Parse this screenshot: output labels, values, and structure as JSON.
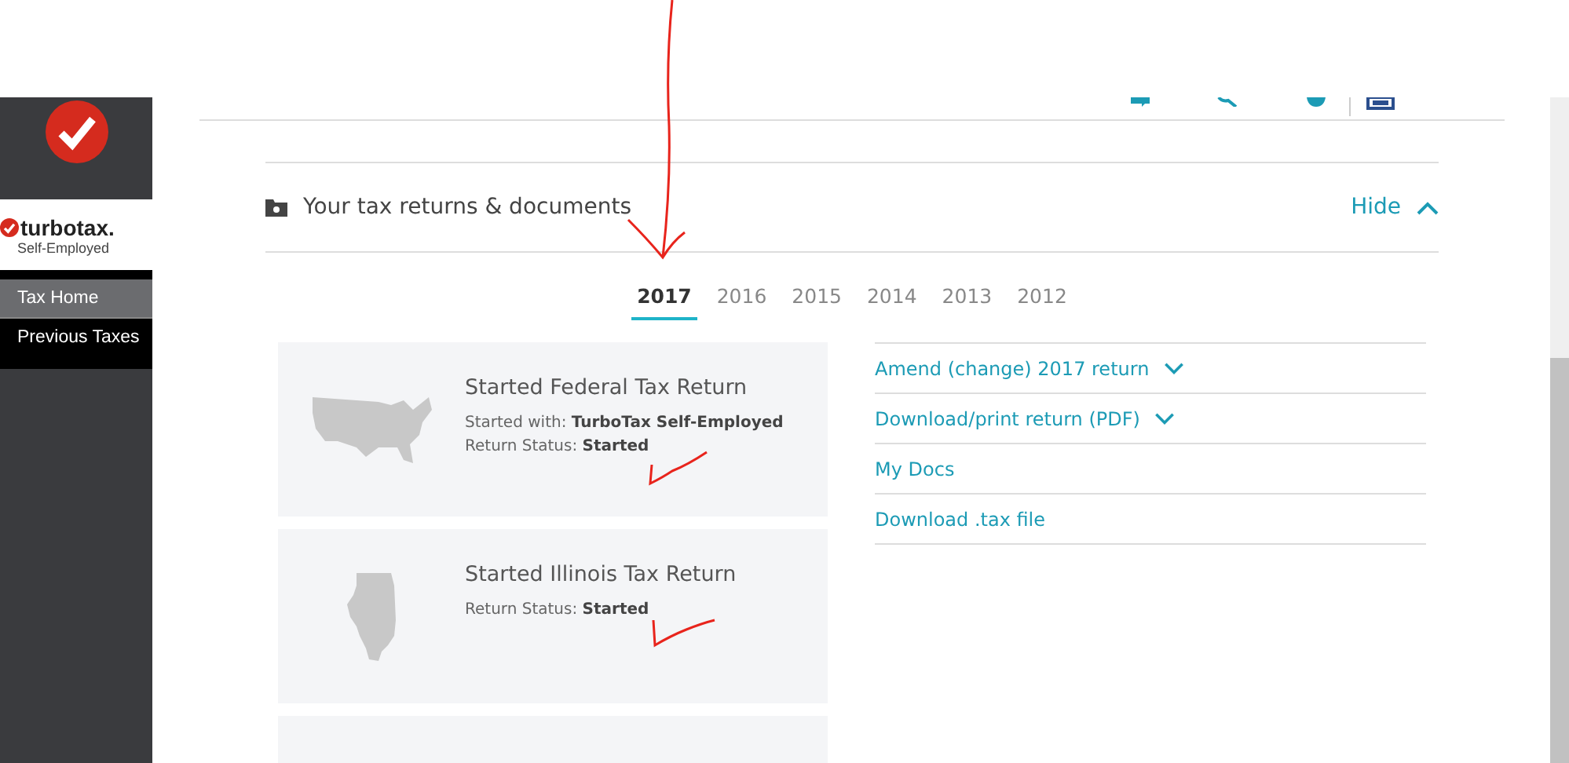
{
  "sidebar": {
    "brand": "turbotax.",
    "edition": "Self-Employed",
    "items": [
      {
        "label": "Tax Home",
        "selected": true
      },
      {
        "label": "Previous Taxes",
        "selected": false
      }
    ]
  },
  "section": {
    "title": "Your tax returns & documents",
    "toggle": "Hide",
    "tabs": [
      {
        "label": "2017",
        "selected": true
      },
      {
        "label": "2016",
        "selected": false
      },
      {
        "label": "2015",
        "selected": false
      },
      {
        "label": "2014",
        "selected": false
      },
      {
        "label": "2013",
        "selected": false
      },
      {
        "label": "2012",
        "selected": false
      }
    ],
    "returns": [
      {
        "kind": "federal",
        "title": "Started Federal Tax Return",
        "details": [
          {
            "label": "Started with:",
            "value": "TurboTax Self-Employed"
          },
          {
            "label": "Return Status:",
            "value": "Started"
          }
        ]
      },
      {
        "kind": "state",
        "title": "Started Illinois Tax Return",
        "details": [
          {
            "label": "Return Status:",
            "value": "Started"
          }
        ]
      }
    ],
    "links": [
      {
        "label": "Amend (change) 2017 return",
        "dropdown": true
      },
      {
        "label": "Download/print return (PDF)",
        "dropdown": true
      },
      {
        "label": "My Docs",
        "dropdown": false
      },
      {
        "label": "Download .tax file",
        "dropdown": false
      }
    ]
  }
}
